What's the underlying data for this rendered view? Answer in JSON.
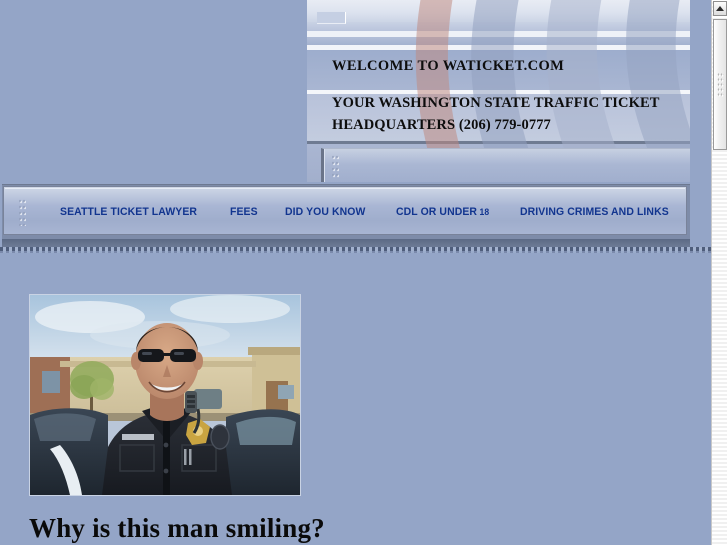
{
  "site": {
    "background_color": "#94a5c7"
  },
  "banner": {
    "welcome_line": "WELCOME TO WATICKET.COM",
    "headquarters_line": "YOUR WASHINGTON STATE TRAFFIC TICKET HEADQUARTERS (206) 779-0777",
    "arc_colors": {
      "salmon": "#c99a92",
      "blue_grey": "#8e9cbb",
      "pale": "#b4bfd6"
    }
  },
  "nav": {
    "link_color": "#12358f",
    "items": [
      {
        "label": "SEATTLE TICKET LAWYER"
      },
      {
        "label": "FEES"
      },
      {
        "label": "DID YOU KNOW"
      },
      {
        "label": "CDL OR UNDER",
        "suffix": " 18"
      },
      {
        "label": "DRIVING CRIMES AND LINKS"
      }
    ]
  },
  "main": {
    "headline": "Why is this man smiling?",
    "photo": {
      "alt": "Smiling police officer wearing sunglasses standing beside a patrol car in front of a tan building",
      "sky_color": "#b9cde0",
      "building_color": "#d8cba6",
      "uniform_color": "#23262c",
      "badge_color": "#c9a441",
      "car_color": "#2a3440"
    }
  },
  "scrollbar": {
    "up_arrow_icon": "scroll-up-arrow-icon",
    "position_percent": 0
  }
}
